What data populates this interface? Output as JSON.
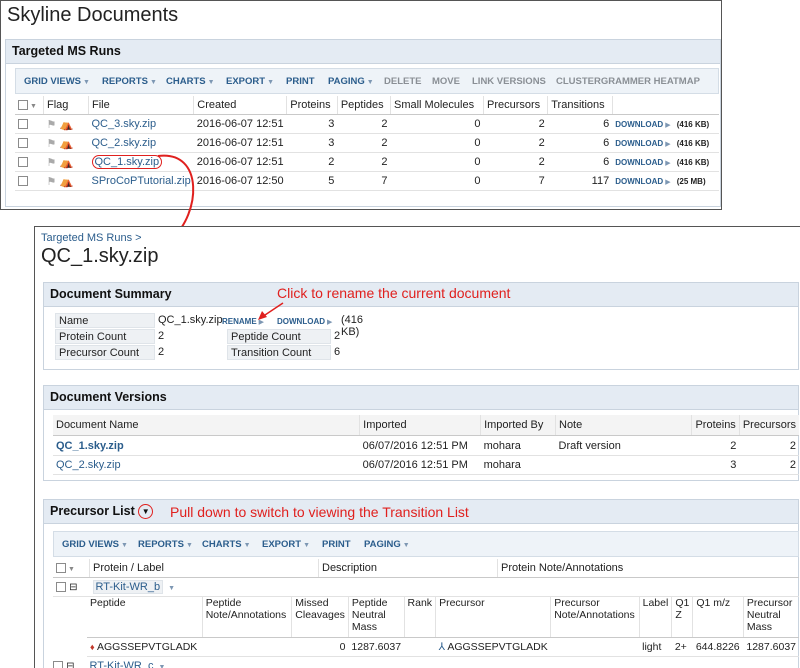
{
  "app_title": "Skyline Documents",
  "runs": {
    "section_title": "Targeted MS Runs",
    "toolbar": [
      "GRID VIEWS",
      "REPORTS",
      "CHARTS",
      "EXPORT",
      "PRINT",
      "PAGING",
      "DELETE",
      "MOVE",
      "LINK VERSIONS",
      "CLUSTERGRAMMER HEATMAP"
    ],
    "columns": [
      "Flag",
      "File",
      "Created",
      "Proteins",
      "Peptides",
      "Small Molecules",
      "Precursors",
      "Transitions"
    ],
    "rows": [
      {
        "file": "QC_3.sky.zip",
        "created": "2016-06-07 12:51",
        "proteins": "3",
        "peptides": "2",
        "small": "0",
        "precursors": "2",
        "transitions": "6",
        "download": "DOWNLOAD",
        "size": "(416 KB)"
      },
      {
        "file": "QC_2.sky.zip",
        "created": "2016-06-07 12:51",
        "proteins": "3",
        "peptides": "2",
        "small": "0",
        "precursors": "2",
        "transitions": "6",
        "download": "DOWNLOAD",
        "size": "(416 KB)"
      },
      {
        "file": "QC_1.sky.zip",
        "created": "2016-06-07 12:51",
        "proteins": "2",
        "peptides": "2",
        "small": "0",
        "precursors": "2",
        "transitions": "6",
        "download": "DOWNLOAD",
        "size": "(416 KB)"
      },
      {
        "file": "SProCoPTutorial.zip",
        "created": "2016-06-07 12:50",
        "proteins": "5",
        "peptides": "7",
        "small": "0",
        "precursors": "7",
        "transitions": "117",
        "download": "DOWNLOAD",
        "size": "(25 MB)"
      }
    ]
  },
  "doc": {
    "breadcrumb": "Targeted MS Runs >",
    "title": "QC_1.sky.zip",
    "summary": {
      "section_title": "Document Summary",
      "name_label": "Name",
      "name_value": "QC_1.sky.zip",
      "rename": "RENAME",
      "download": "DOWNLOAD",
      "size": "(416 KB)",
      "protein_count_label": "Protein Count",
      "protein_count": "2",
      "peptide_count_label": "Peptide Count",
      "peptide_count": "2",
      "precursor_count_label": "Precursor Count",
      "precursor_count": "2",
      "transition_count_label": "Transition Count",
      "transition_count": "6"
    },
    "versions": {
      "section_title": "Document Versions",
      "columns": [
        "Document Name",
        "Imported",
        "Imported By",
        "Note",
        "Proteins",
        "Precursors"
      ],
      "rows": [
        {
          "name": "QC_1.sky.zip",
          "imported": "06/07/2016 12:51 PM",
          "by": "mohara",
          "note": "Draft version",
          "proteins": "2",
          "precursors": "2"
        },
        {
          "name": "QC_2.sky.zip",
          "imported": "06/07/2016 12:51 PM",
          "by": "mohara",
          "note": "",
          "proteins": "3",
          "precursors": "2"
        }
      ]
    },
    "precursor": {
      "section_title": "Precursor List",
      "toolbar": [
        "GRID VIEWS",
        "REPORTS",
        "CHARTS",
        "EXPORT",
        "PRINT",
        "PAGING"
      ],
      "columns": [
        "Protein / Label",
        "Description",
        "Protein Note/Annotations"
      ],
      "protein_1": "RT-Kit-WR_b",
      "protein_2": "RT-Kit-WR_c",
      "sub_columns": [
        "Peptide",
        "Peptide Note/Annotations",
        "Missed Cleavages",
        "Peptide Neutral Mass",
        "Rank",
        "Precursor",
        "Precursor Note/Annotations",
        "Label",
        "Q1 Z",
        "Q1 m/z",
        "Precursor Neutral Mass"
      ],
      "row": {
        "peptide": "AGGSSEPVTGLADK",
        "missed": "0",
        "mass": "1287.6037",
        "precursor": "AGGSSEPVTGLADK",
        "label": "light",
        "z": "2+",
        "mz": "644.8226",
        "pmass": "1287.6037"
      }
    }
  },
  "annotations": {
    "rename_hint": "Click to rename the current document",
    "pulldown_hint": "Pull down to switch to viewing the Transition List"
  },
  "colors": {
    "accent": "#e0201e",
    "link": "#2b5d8c",
    "header_bg": "#e4ebf3"
  }
}
